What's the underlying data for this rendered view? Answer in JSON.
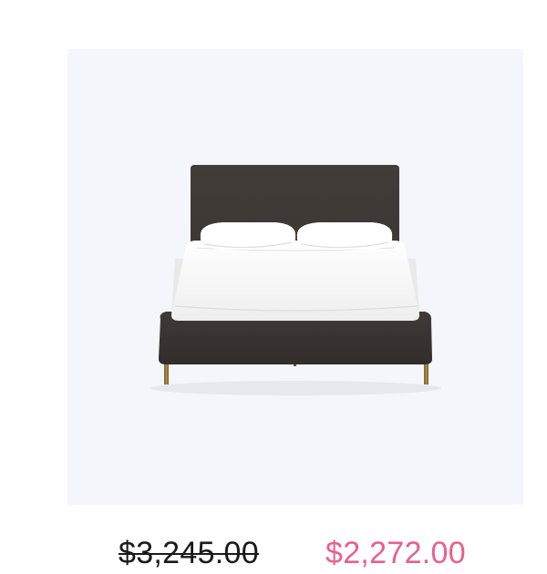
{
  "product": {
    "image_subject": "bed-icon",
    "pricing": {
      "original_price": "$3,245.00",
      "sale_price": "$2,272.00"
    }
  },
  "colors": {
    "image_background": "#f4f6fb",
    "original_price_text": "#1a1a1a",
    "sale_price_text": "#ea5f8c",
    "bed_upholstery": "#3d3834",
    "bedding": "#ffffff",
    "legs": "#9a7a3c"
  }
}
